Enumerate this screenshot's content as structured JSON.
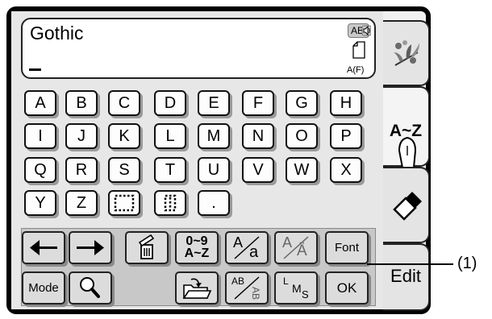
{
  "display": {
    "font_name": "Gothic",
    "case_badge": "AB",
    "mode_label": "A(F)"
  },
  "keyboard": {
    "rows": [
      [
        "A",
        "B",
        "C",
        "D",
        "E",
        "F",
        "G",
        "H"
      ],
      [
        "I",
        "J",
        "K",
        "L",
        "M",
        "N",
        "O",
        "P"
      ],
      [
        "Q",
        "R",
        "S",
        "T",
        "U",
        "V",
        "W",
        "X"
      ],
      [
        "Y",
        "Z"
      ]
    ],
    "period": "."
  },
  "function_bar": {
    "mode_label": "Mode",
    "font_label": "Font",
    "ok_label": "OK",
    "charset_top": "0~9",
    "charset_bottom": "A~Z",
    "case_upper": "A",
    "case_lower": "a",
    "accent_base": "A",
    "accent_target": "Ä",
    "orient_text": "AB",
    "size_l": "L",
    "size_m": "M",
    "size_s": "S"
  },
  "tabs": {
    "alphabet": "A~Z",
    "edit": "Edit"
  },
  "callout": "(1)",
  "icons": [
    "speaker-icon",
    "page-icon",
    "arrow-left-icon",
    "arrow-right-icon",
    "trash-icon",
    "magnify-icon",
    "folder-open-icon",
    "flower-icon",
    "hand-pointer-icon",
    "eraser-icon"
  ]
}
